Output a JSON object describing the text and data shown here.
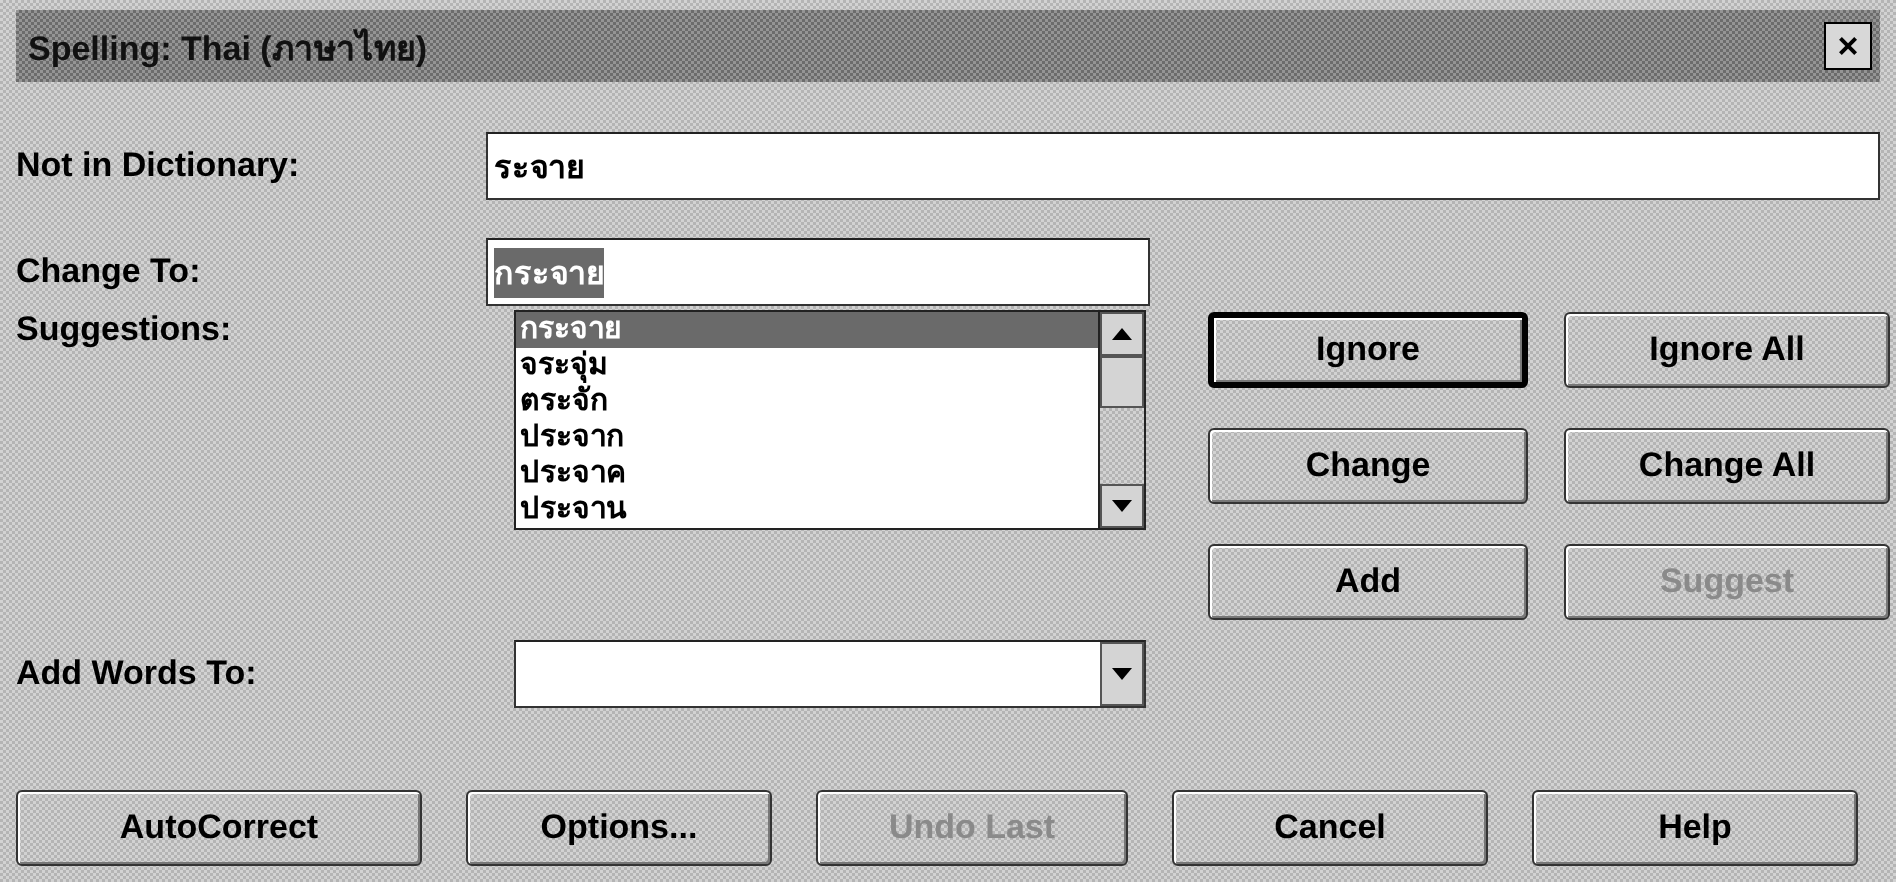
{
  "window": {
    "title": "Spelling: Thai (ภาษาไทย)",
    "close": "×"
  },
  "not_in_dictionary": {
    "label": "Not in Dictionary:",
    "value": "ระจาย"
  },
  "change_to": {
    "label": "Change To:",
    "value": "กระจาย",
    "selected": true
  },
  "suggestions": {
    "label": "Suggestions:",
    "items": [
      {
        "text": "กระจาย",
        "selected": true
      },
      {
        "text": "จระจุ่ม",
        "selected": false
      },
      {
        "text": "ตระจัก",
        "selected": false
      },
      {
        "text": "ประจาก",
        "selected": false
      },
      {
        "text": "ประจาค",
        "selected": false
      },
      {
        "text": "ประจาน",
        "selected": false
      }
    ]
  },
  "side_buttons": [
    {
      "label": "Ignore",
      "disabled": false,
      "default": true
    },
    {
      "label": "Ignore All",
      "disabled": false,
      "default": false
    },
    {
      "label": "Change",
      "disabled": false,
      "default": false
    },
    {
      "label": "Change All",
      "disabled": false,
      "default": false
    },
    {
      "label": "Add",
      "disabled": false,
      "default": false
    },
    {
      "label": "Suggest",
      "disabled": true,
      "default": false
    }
  ],
  "add_words_to": {
    "label": "Add Words To:"
  },
  "bottom_buttons": [
    {
      "label": "AutoCorrect",
      "disabled": false
    },
    {
      "label": "Options...",
      "disabled": false
    },
    {
      "label": "Undo Last",
      "disabled": true
    },
    {
      "label": "Cancel",
      "disabled": false
    },
    {
      "label": "Help",
      "disabled": false
    }
  ]
}
